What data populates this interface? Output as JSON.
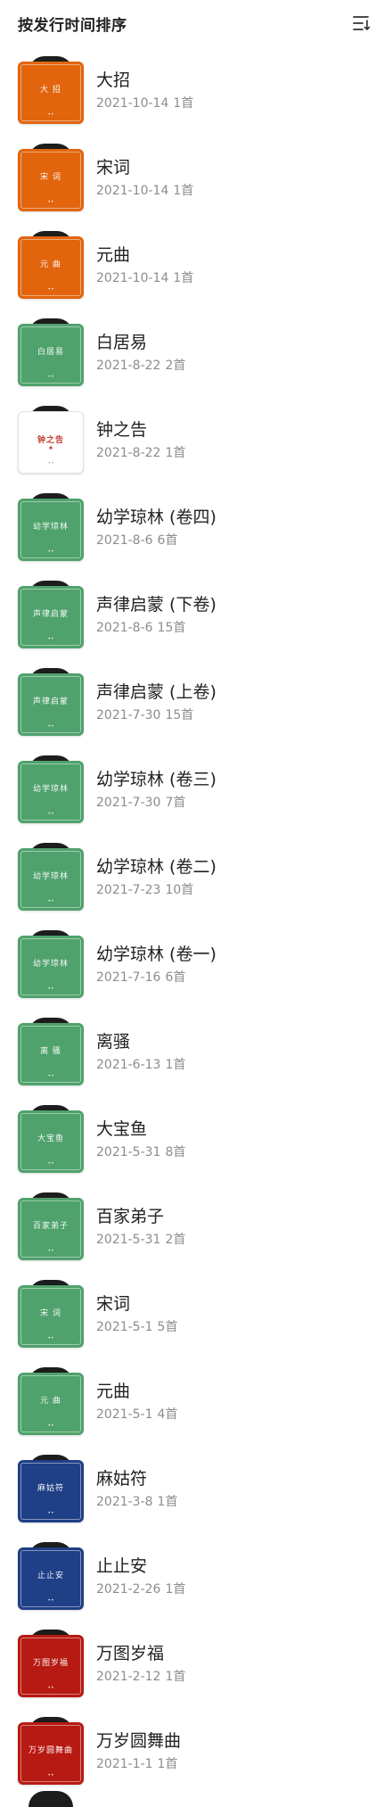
{
  "header": {
    "title": "按发行时间排序",
    "sort_icon": "sort-list-icon"
  },
  "colors": {
    "orange": "#e2650e",
    "green": "#4fa26c",
    "white": "#ffffff",
    "navy": "#1f3f86",
    "red": "#b71a12",
    "vinyl": "#1d1d1d"
  },
  "albums": [
    {
      "title": "大招",
      "date": "2021-10-14",
      "count": "1首",
      "cover_text": "大 招",
      "cover_color": "#e2650e"
    },
    {
      "title": "宋词",
      "date": "2021-10-14",
      "count": "1首",
      "cover_text": "宋 词",
      "cover_color": "#e2650e"
    },
    {
      "title": "元曲",
      "date": "2021-10-14",
      "count": "1首",
      "cover_text": "元 曲",
      "cover_color": "#e2650e"
    },
    {
      "title": "白居易",
      "date": "2021-8-22",
      "count": "2首",
      "cover_text": "白居易",
      "cover_color": "#4fa26c"
    },
    {
      "title": "钟之告",
      "date": "2021-8-22",
      "count": "1首",
      "cover_text": "钟之告",
      "cover_color": "#ffffff"
    },
    {
      "title": "幼学琼林 (卷四)",
      "date": "2021-8-6",
      "count": "6首",
      "cover_text": "幼学琼林",
      "cover_color": "#4fa26c"
    },
    {
      "title": "声律启蒙 (下卷)",
      "date": "2021-8-6",
      "count": "15首",
      "cover_text": "声律启蒙",
      "cover_color": "#4fa26c"
    },
    {
      "title": "声律启蒙 (上卷)",
      "date": "2021-7-30",
      "count": "15首",
      "cover_text": "声律启蒙",
      "cover_color": "#4fa26c"
    },
    {
      "title": "幼学琼林 (卷三)",
      "date": "2021-7-30",
      "count": "7首",
      "cover_text": "幼学琼林",
      "cover_color": "#4fa26c"
    },
    {
      "title": "幼学琼林 (卷二)",
      "date": "2021-7-23",
      "count": "10首",
      "cover_text": "幼学琼林",
      "cover_color": "#4fa26c"
    },
    {
      "title": "幼学琼林 (卷一)",
      "date": "2021-7-16",
      "count": "6首",
      "cover_text": "幼学琼林",
      "cover_color": "#4fa26c"
    },
    {
      "title": "离骚",
      "date": "2021-6-13",
      "count": "1首",
      "cover_text": "离 骚",
      "cover_color": "#4fa26c"
    },
    {
      "title": "大宝鱼",
      "date": "2021-5-31",
      "count": "8首",
      "cover_text": "大宝鱼",
      "cover_color": "#4fa26c"
    },
    {
      "title": "百家弟子",
      "date": "2021-5-31",
      "count": "2首",
      "cover_text": "百家弟子",
      "cover_color": "#4fa26c"
    },
    {
      "title": "宋词",
      "date": "2021-5-1",
      "count": "5首",
      "cover_text": "宋 词",
      "cover_color": "#4fa26c"
    },
    {
      "title": "元曲",
      "date": "2021-5-1",
      "count": "4首",
      "cover_text": "元 曲",
      "cover_color": "#4fa26c"
    },
    {
      "title": "麻姑符",
      "date": "2021-3-8",
      "count": "1首",
      "cover_text": "麻姑符",
      "cover_color": "#1f3f86"
    },
    {
      "title": "止止安",
      "date": "2021-2-26",
      "count": "1首",
      "cover_text": "止止安",
      "cover_color": "#1f3f86"
    },
    {
      "title": "万图岁福",
      "date": "2021-2-12",
      "count": "1首",
      "cover_text": "万图岁福",
      "cover_color": "#b71a12"
    },
    {
      "title": "万岁圆舞曲",
      "date": "2021-1-1",
      "count": "1首",
      "cover_text": "万岁圆舞曲",
      "cover_color": "#b71a12"
    }
  ]
}
